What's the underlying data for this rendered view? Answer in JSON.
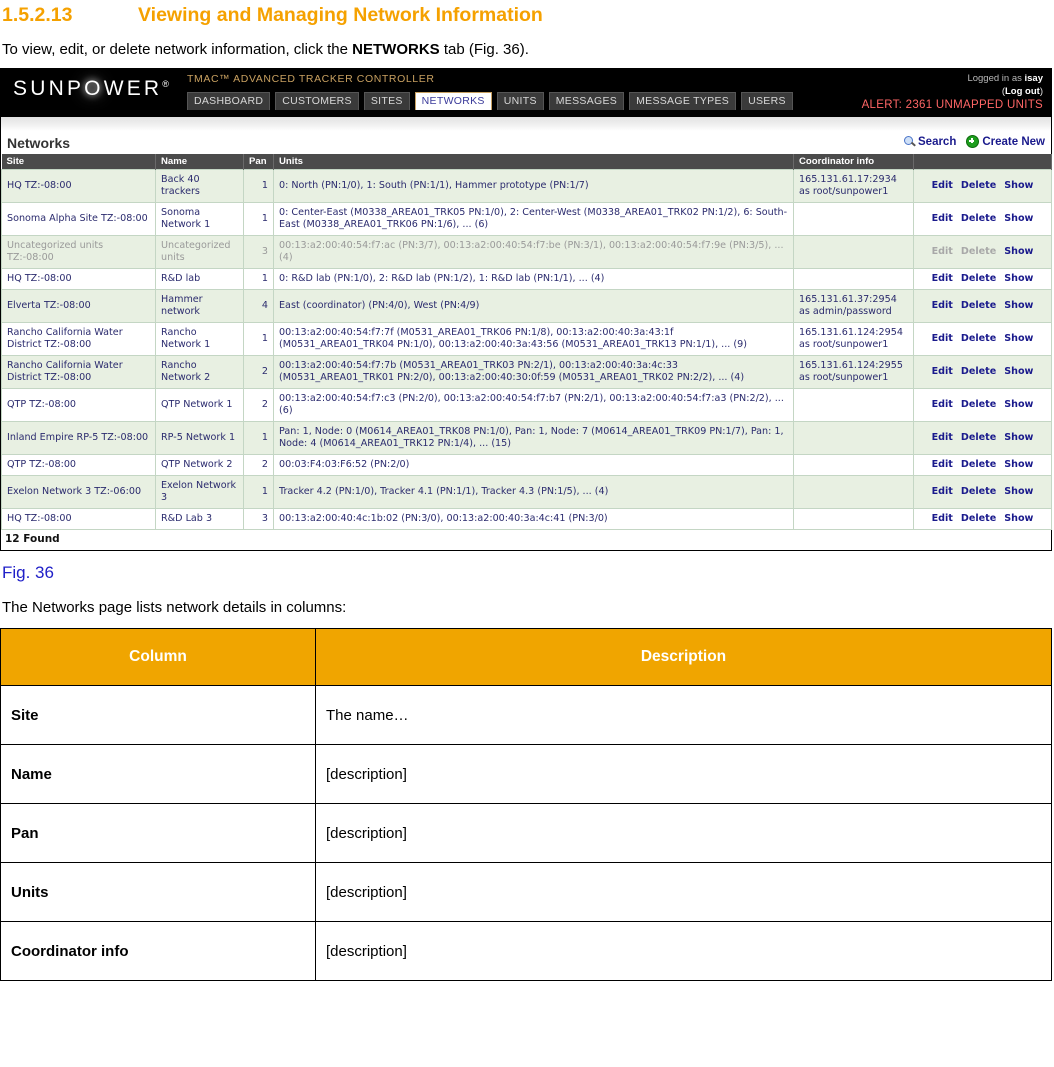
{
  "doc": {
    "section_number": "1.5.2.13",
    "section_title": "Viewing and Managing Network Information",
    "intro_before": "To view, edit, or delete network information, click the ",
    "intro_bold": "NETWORKS",
    "intro_after": " tab (Fig. 36).",
    "figure_caption": "Fig. 36",
    "after_figure": "The Networks page lists network details in columns:"
  },
  "app": {
    "brand": "SUNPOWER",
    "product_title": "TMAC™ ADVANCED TRACKER CONTROLLER",
    "tabs": [
      {
        "label": "DASHBOARD",
        "active": false
      },
      {
        "label": "CUSTOMERS",
        "active": false
      },
      {
        "label": "SITES",
        "active": false
      },
      {
        "label": "NETWORKS",
        "active": true
      },
      {
        "label": "UNITS",
        "active": false
      },
      {
        "label": "MESSAGES",
        "active": false
      },
      {
        "label": "MESSAGE TYPES",
        "active": false
      },
      {
        "label": "USERS",
        "active": false
      }
    ],
    "user": {
      "logged_in_prefix": "Logged in as ",
      "username": "isay",
      "logout_open": "(",
      "logout_label": "Log out",
      "logout_close": ")",
      "alert": "ALERT: 2361 UNMAPPED UNITS"
    },
    "page_title": "Networks",
    "actions": {
      "search_label": "Search",
      "create_new_label": "Create New"
    },
    "table": {
      "headers": [
        "Site",
        "Name",
        "Pan",
        "Units",
        "Coordinator info"
      ],
      "ops": {
        "edit": "Edit",
        "delete": "Delete",
        "show": "Show"
      },
      "rows": [
        {
          "site": "HQ TZ:-08:00",
          "name": "Back 40 trackers",
          "pan": "1",
          "units": "0: North (PN:1/0), 1: South (PN:1/1), Hammer prototype (PN:1/7)",
          "coordinator": "165.131.61.17:2934 as root/sunpower1",
          "muted": false
        },
        {
          "site": "Sonoma Alpha Site TZ:-08:00",
          "name": "Sonoma Network 1",
          "pan": "1",
          "units": "0: Center-East (M0338_AREA01_TRK05 PN:1/0), 2: Center-West (M0338_AREA01_TRK02 PN:1/2), 6: South-East (M0338_AREA01_TRK06 PN:1/6), ... (6)",
          "coordinator": "",
          "muted": false
        },
        {
          "site": "Uncategorized units TZ:-08:00",
          "name": "Uncategorized units",
          "pan": "3",
          "units": "00:13:a2:00:40:54:f7:ac (PN:3/7), 00:13:a2:00:40:54:f7:be (PN:3/1), 00:13:a2:00:40:54:f7:9e (PN:3/5), ... (4)",
          "coordinator": "",
          "muted": true
        },
        {
          "site": "HQ TZ:-08:00",
          "name": "R&D lab",
          "pan": "1",
          "units": "0: R&D lab (PN:1/0), 2: R&D lab (PN:1/2), 1: R&D lab (PN:1/1), ... (4)",
          "coordinator": "",
          "muted": false
        },
        {
          "site": "Elverta TZ:-08:00",
          "name": "Hammer network",
          "pan": "4",
          "units": "East (coordinator) (PN:4/0), West (PN:4/9)",
          "coordinator": "165.131.61.37:2954 as admin/password",
          "muted": false
        },
        {
          "site": "Rancho California Water District TZ:-08:00",
          "name": "Rancho Network 1",
          "pan": "1",
          "units": "00:13:a2:00:40:54:f7:7f (M0531_AREA01_TRK06 PN:1/8), 00:13:a2:00:40:3a:43:1f (M0531_AREA01_TRK04 PN:1/0), 00:13:a2:00:40:3a:43:56 (M0531_AREA01_TRK13 PN:1/1), ... (9)",
          "coordinator": "165.131.61.124:2954 as root/sunpower1",
          "muted": false
        },
        {
          "site": "Rancho California Water District TZ:-08:00",
          "name": "Rancho Network 2",
          "pan": "2",
          "units": "00:13:a2:00:40:54:f7:7b (M0531_AREA01_TRK03 PN:2/1), 00:13:a2:00:40:3a:4c:33 (M0531_AREA01_TRK01 PN:2/0), 00:13:a2:00:40:30:0f:59 (M0531_AREA01_TRK02 PN:2/2), ... (4)",
          "coordinator": "165.131.61.124:2955 as root/sunpower1",
          "muted": false
        },
        {
          "site": "QTP TZ:-08:00",
          "name": "QTP Network 1",
          "pan": "2",
          "units": "00:13:a2:00:40:54:f7:c3 (PN:2/0), 00:13:a2:00:40:54:f7:b7 (PN:2/1), 00:13:a2:00:40:54:f7:a3 (PN:2/2), ... (6)",
          "coordinator": "",
          "muted": false
        },
        {
          "site": "Inland Empire RP-5 TZ:-08:00",
          "name": "RP-5 Network 1",
          "pan": "1",
          "units": "Pan: 1, Node: 0 (M0614_AREA01_TRK08 PN:1/0), Pan: 1, Node: 7 (M0614_AREA01_TRK09 PN:1/7), Pan: 1, Node: 4 (M0614_AREA01_TRK12 PN:1/4), ... (15)",
          "coordinator": "",
          "muted": false
        },
        {
          "site": "QTP TZ:-08:00",
          "name": "QTP Network 2",
          "pan": "2",
          "units": "00:03:F4:03:F6:52 (PN:2/0)",
          "coordinator": "",
          "muted": false
        },
        {
          "site": "Exelon Network 3 TZ:-06:00",
          "name": "Exelon Network 3",
          "pan": "1",
          "units": "Tracker 4.2 (PN:1/0), Tracker 4.1 (PN:1/1), Tracker 4.3 (PN:1/5), ... (4)",
          "coordinator": "",
          "muted": false
        },
        {
          "site": "HQ TZ:-08:00",
          "name": "R&D Lab 3",
          "pan": "3",
          "units": "00:13:a2:00:40:4c:1b:02 (PN:3/0), 00:13:a2:00:40:3a:4c:41 (PN:3/0)",
          "coordinator": "",
          "muted": false
        }
      ],
      "footer": "12 Found"
    }
  },
  "description_table": {
    "headers": [
      "Column",
      "Description"
    ],
    "rows": [
      {
        "column": "Site",
        "description": "The name…"
      },
      {
        "column": "Name",
        "description": "[description]"
      },
      {
        "column": "Pan",
        "description": "[description]"
      },
      {
        "column": "Units",
        "description": "[description]"
      },
      {
        "column": "Coordinator info",
        "description": "[description]"
      }
    ]
  },
  "colors": {
    "heading": "#F5A100",
    "figure_caption": "#2020C8",
    "table_header_bg": "#F0A500",
    "alert": "#FF6666",
    "link": "#1a1a8c"
  }
}
